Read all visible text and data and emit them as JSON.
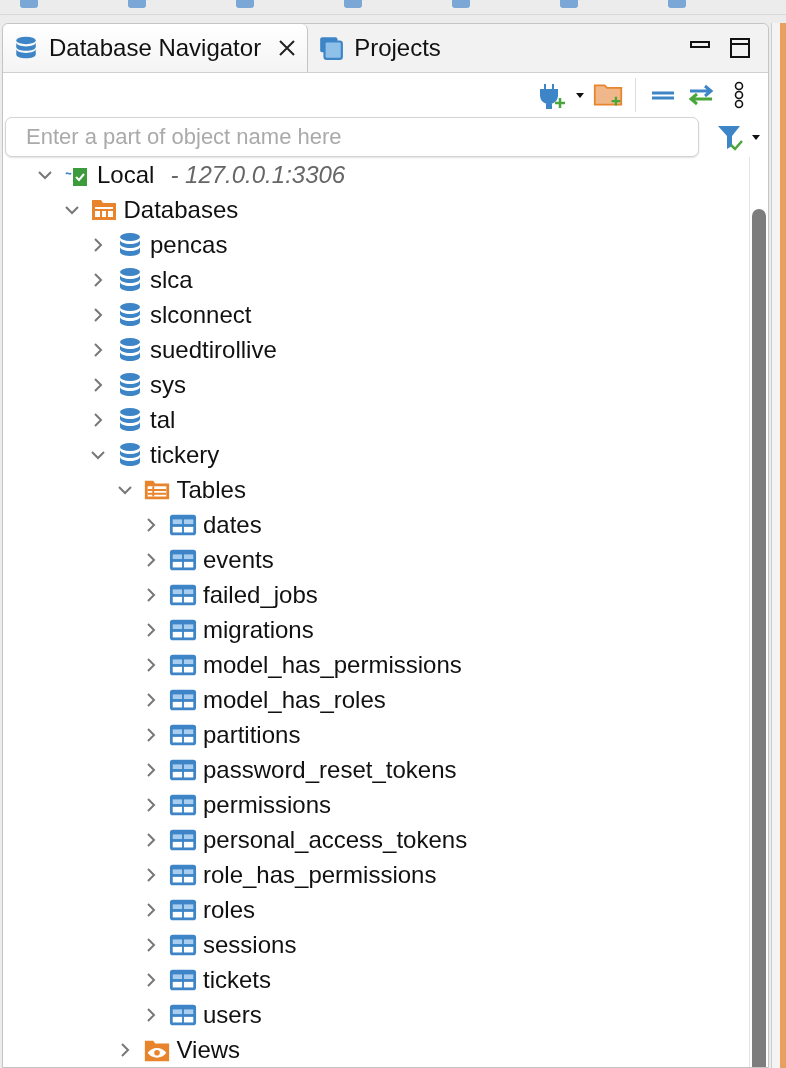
{
  "tabs": [
    {
      "label": "Database Navigator",
      "selected": true,
      "closable": true
    },
    {
      "label": "Projects",
      "selected": false,
      "closable": false
    }
  ],
  "search": {
    "placeholder": "Enter a part of object name here"
  },
  "tree": [
    {
      "kind": "connection",
      "label": "Local",
      "detail": "- 127.0.0.1:3306",
      "expanded": true,
      "children": [
        {
          "kind": "databases",
          "label": "Databases",
          "expanded": true,
          "children": [
            {
              "kind": "database",
              "label": "pencas",
              "expanded": false
            },
            {
              "kind": "database",
              "label": "slca",
              "expanded": false
            },
            {
              "kind": "database",
              "label": "slconnect",
              "expanded": false
            },
            {
              "kind": "database",
              "label": "suedtirollive",
              "expanded": false
            },
            {
              "kind": "database",
              "label": "sys",
              "expanded": false
            },
            {
              "kind": "database",
              "label": "tal",
              "expanded": false
            },
            {
              "kind": "database",
              "label": "tickery",
              "expanded": true,
              "children": [
                {
                  "kind": "tables",
                  "label": "Tables",
                  "expanded": true,
                  "children": [
                    {
                      "kind": "table",
                      "label": "dates",
                      "expanded": false
                    },
                    {
                      "kind": "table",
                      "label": "events",
                      "expanded": false
                    },
                    {
                      "kind": "table",
                      "label": "failed_jobs",
                      "expanded": false
                    },
                    {
                      "kind": "table",
                      "label": "migrations",
                      "expanded": false
                    },
                    {
                      "kind": "table",
                      "label": "model_has_permissions",
                      "expanded": false
                    },
                    {
                      "kind": "table",
                      "label": "model_has_roles",
                      "expanded": false
                    },
                    {
                      "kind": "table",
                      "label": "partitions",
                      "expanded": false
                    },
                    {
                      "kind": "table",
                      "label": "password_reset_tokens",
                      "expanded": false
                    },
                    {
                      "kind": "table",
                      "label": "permissions",
                      "expanded": false
                    },
                    {
                      "kind": "table",
                      "label": "personal_access_tokens",
                      "expanded": false
                    },
                    {
                      "kind": "table",
                      "label": "role_has_permissions",
                      "expanded": false
                    },
                    {
                      "kind": "table",
                      "label": "roles",
                      "expanded": false
                    },
                    {
                      "kind": "table",
                      "label": "sessions",
                      "expanded": false
                    },
                    {
                      "kind": "table",
                      "label": "tickets",
                      "expanded": false
                    },
                    {
                      "kind": "table",
                      "label": "users",
                      "expanded": false
                    }
                  ]
                },
                {
                  "kind": "views",
                  "label": "Views",
                  "expanded": false
                }
              ]
            }
          ]
        }
      ]
    }
  ]
}
